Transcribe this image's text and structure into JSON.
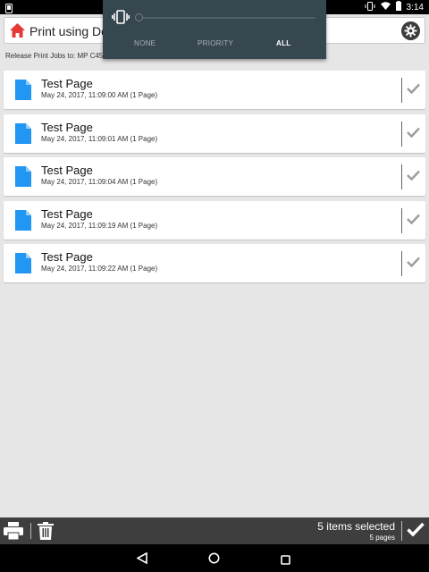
{
  "status_bar": {
    "time": "3:14"
  },
  "header": {
    "title": "Print using Devi"
  },
  "release_text": "Release Print Jobs to: MP C45…",
  "jobs": [
    {
      "title": "Test Page",
      "meta": "May 24, 2017, 11:09:00 AM (1 Page)"
    },
    {
      "title": "Test Page",
      "meta": "May 24, 2017, 11:09:01 AM (1 Page)"
    },
    {
      "title": "Test Page",
      "meta": "May 24, 2017, 11:09:04 AM (1 Page)"
    },
    {
      "title": "Test Page",
      "meta": "May 24, 2017, 11:09:19 AM (1 Page)"
    },
    {
      "title": "Test Page",
      "meta": "May 24, 2017, 11:09:22 AM (1 Page)"
    }
  ],
  "toolbar": {
    "selected_count": "5 items selected",
    "selected_pages": "5 pages"
  },
  "interruptions_panel": {
    "modes": [
      "NONE",
      "PRIORITY",
      "ALL"
    ],
    "active_mode": "ALL"
  },
  "icons": {
    "home": "home-icon",
    "settings": "gear-icon",
    "document": "document-icon",
    "check": "check-icon",
    "printer": "printer-icon",
    "trash": "trash-icon",
    "vibrate": "vibrate-icon"
  },
  "colors": {
    "accent_blue": "#2196f3",
    "home_red": "#e53935",
    "toolbar": "#3e3e3e",
    "panel": "#37474f"
  }
}
